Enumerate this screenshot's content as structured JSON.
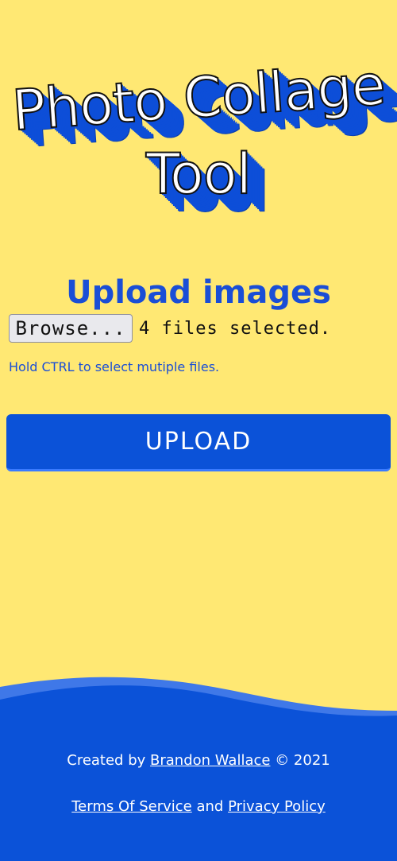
{
  "header": {
    "title_line1": "Photo Collage",
    "title_line2": "Tool"
  },
  "main": {
    "heading": "Upload images",
    "file_input": {
      "button_label": "Browse...",
      "status": "4 files selected."
    },
    "hint": "Hold CTRL to select mutiple files.",
    "upload_label": "UPLOAD"
  },
  "footer": {
    "created_by": "Created by",
    "author_link": "Brandon Wallace",
    "copyright": "© 2021",
    "terms_link": "Terms Of Service",
    "and": "and",
    "privacy_link": "Privacy Policy"
  },
  "colors": {
    "background": "#ffe873",
    "primary_blue": "#0b52d8",
    "heading_blue": "#1a4ed6"
  }
}
